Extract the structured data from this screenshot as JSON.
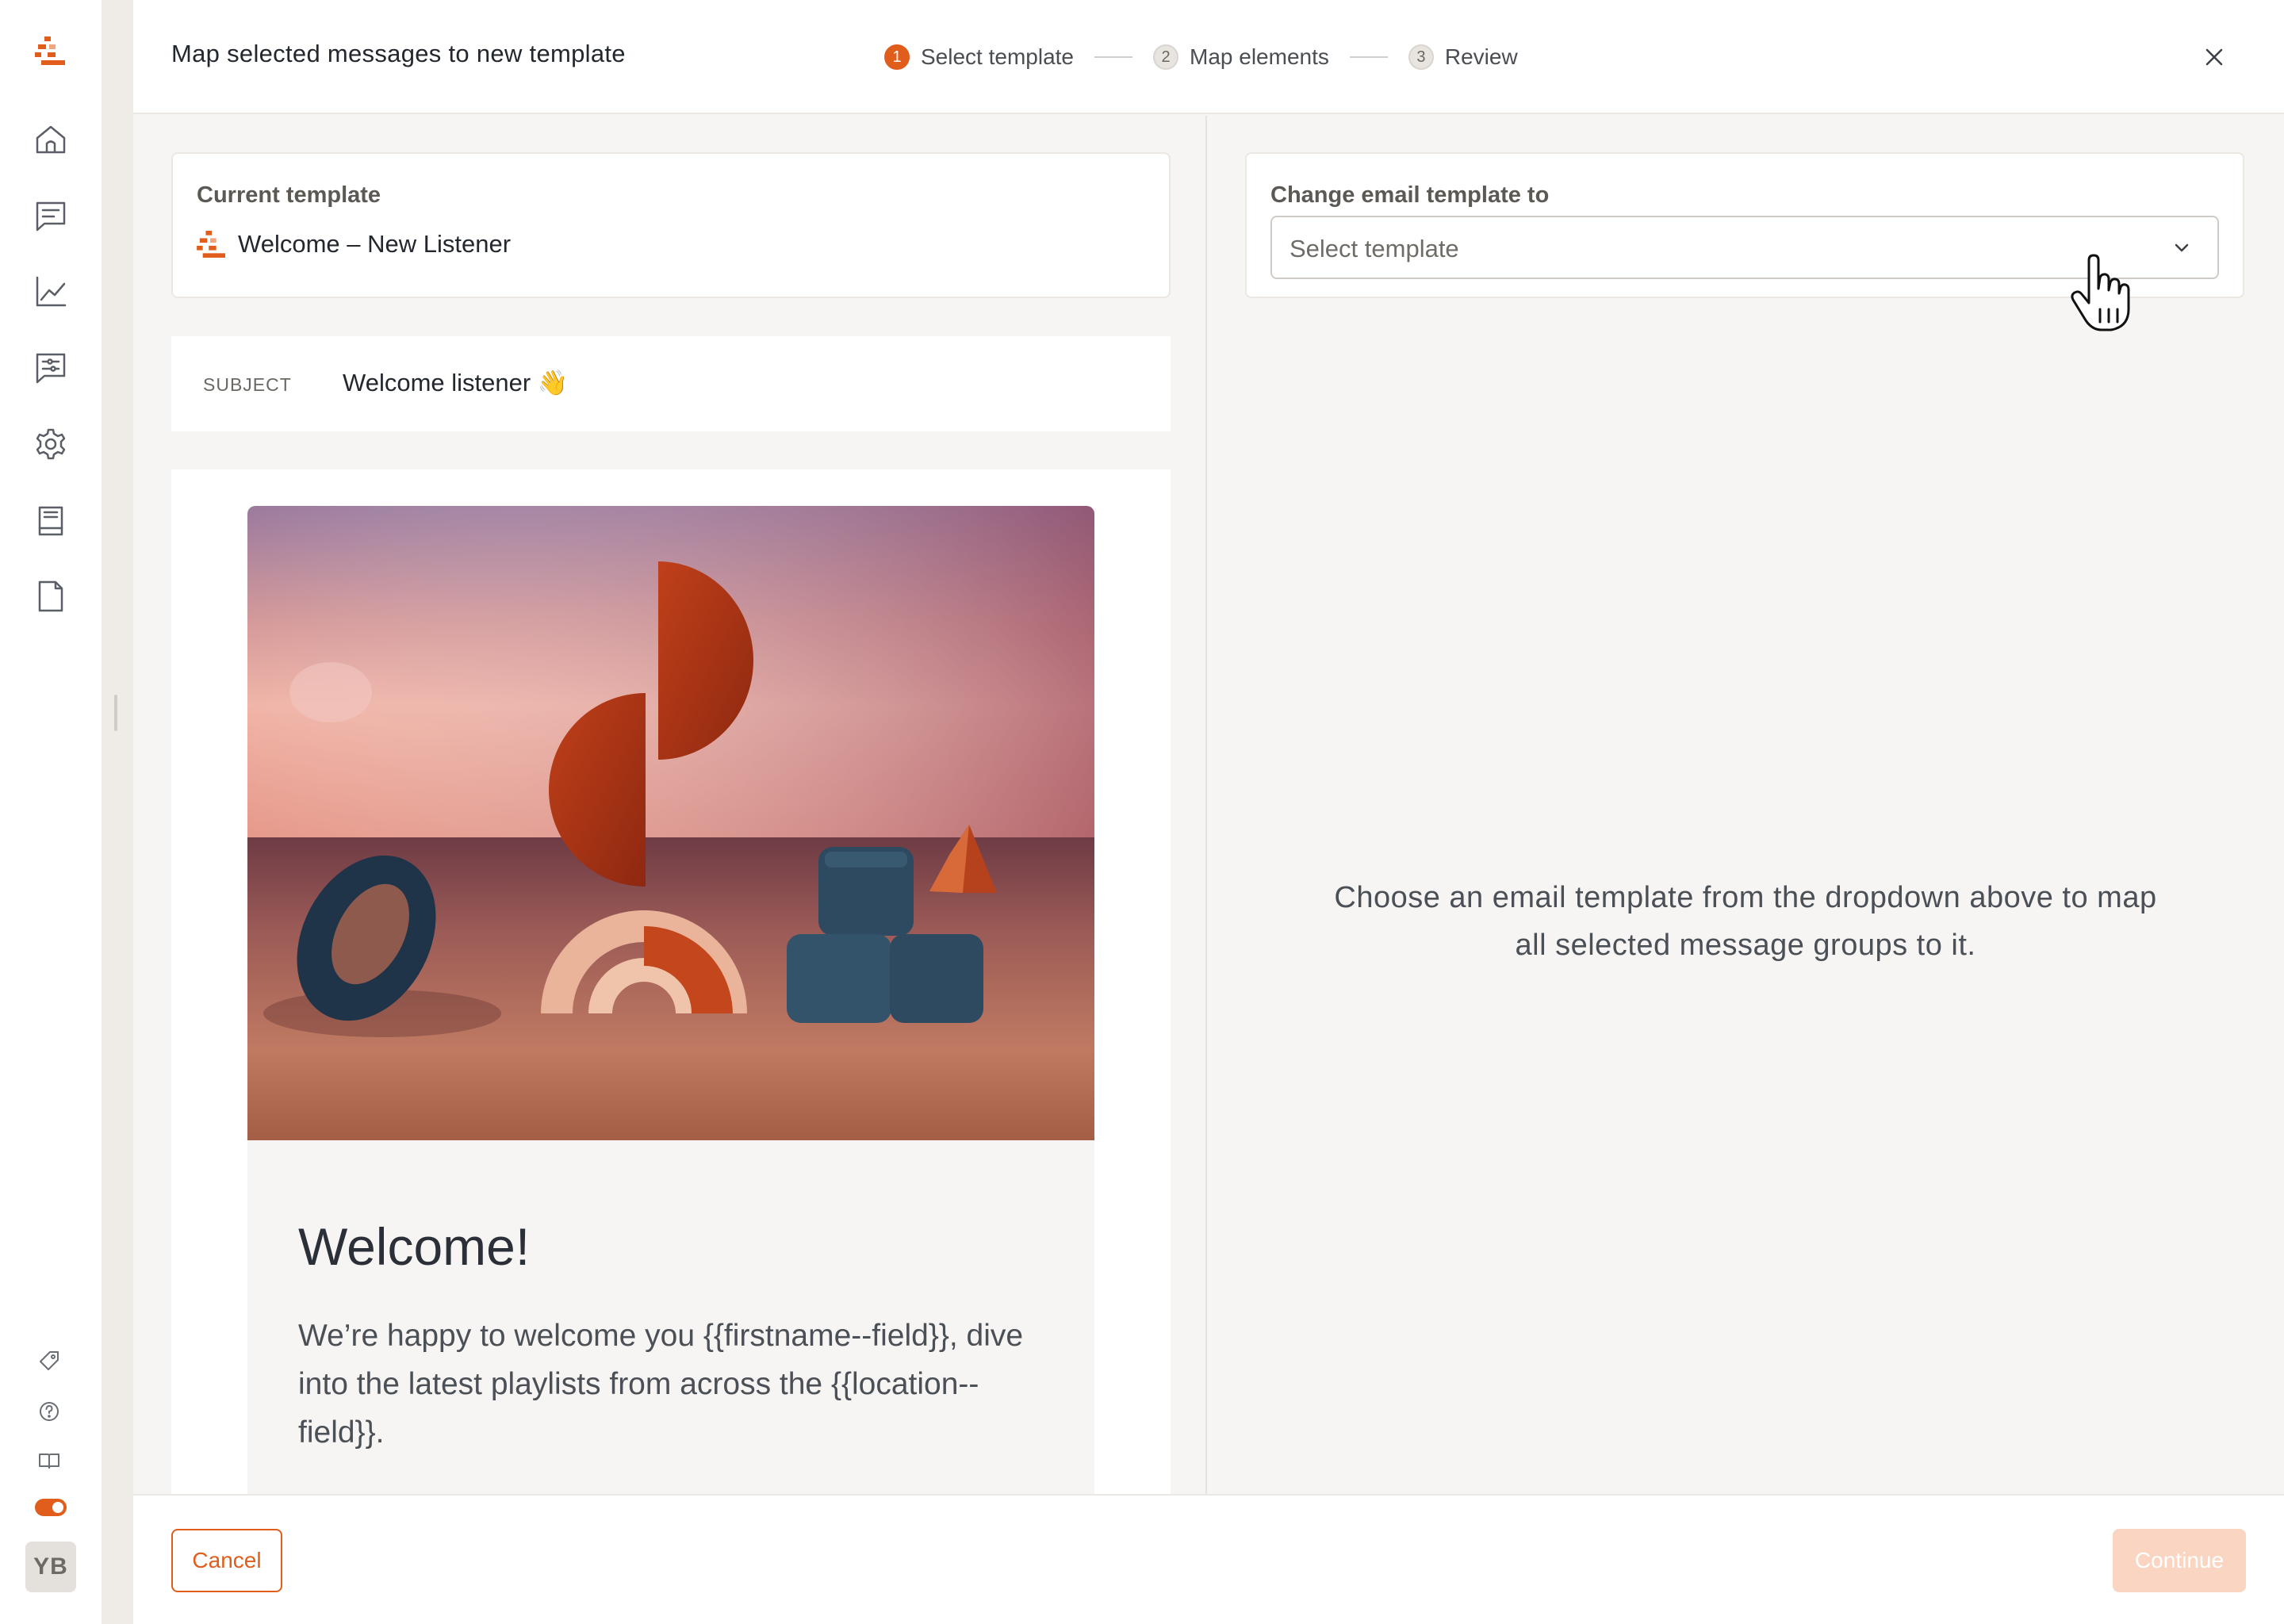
{
  "colors": {
    "accent": "#e05d1c",
    "accent_disabled": "#fad6c2",
    "text_primary": "#23272e",
    "text_secondary": "#4b4f56",
    "surface": "#f6f5f3"
  },
  "app_sidebar": {
    "nav_icons": [
      "home-icon",
      "messages-icon",
      "analytics-icon",
      "templates-icon",
      "settings-icon",
      "library-icon",
      "document-icon"
    ],
    "bottom_icons": [
      "tag-icon",
      "help-icon",
      "book-icon"
    ],
    "toggle_on": true,
    "avatar_initials": "YB"
  },
  "modal": {
    "title": "Map selected messages to new template",
    "steps": [
      {
        "number": "1",
        "label": "Select template",
        "active": true
      },
      {
        "number": "2",
        "label": "Map elements",
        "active": false
      },
      {
        "number": "3",
        "label": "Review",
        "active": false
      }
    ]
  },
  "current_template": {
    "label": "Current template",
    "name": "Welcome – New Listener"
  },
  "subject": {
    "label": "SUBJECT",
    "text": "Welcome listener 👋"
  },
  "email_preview": {
    "heading": "Welcome!",
    "body": "We’re happy to welcome you {{firstname--field}}, dive into the latest playlists from across the {{location--field}}."
  },
  "change_template": {
    "label": "Change email template to",
    "select_placeholder": "Select template"
  },
  "empty_state": {
    "message": "Choose an email template from the dropdown above to map all selected message groups to it."
  },
  "footer": {
    "cancel_label": "Cancel",
    "continue_label": "Continue",
    "continue_disabled": true
  }
}
